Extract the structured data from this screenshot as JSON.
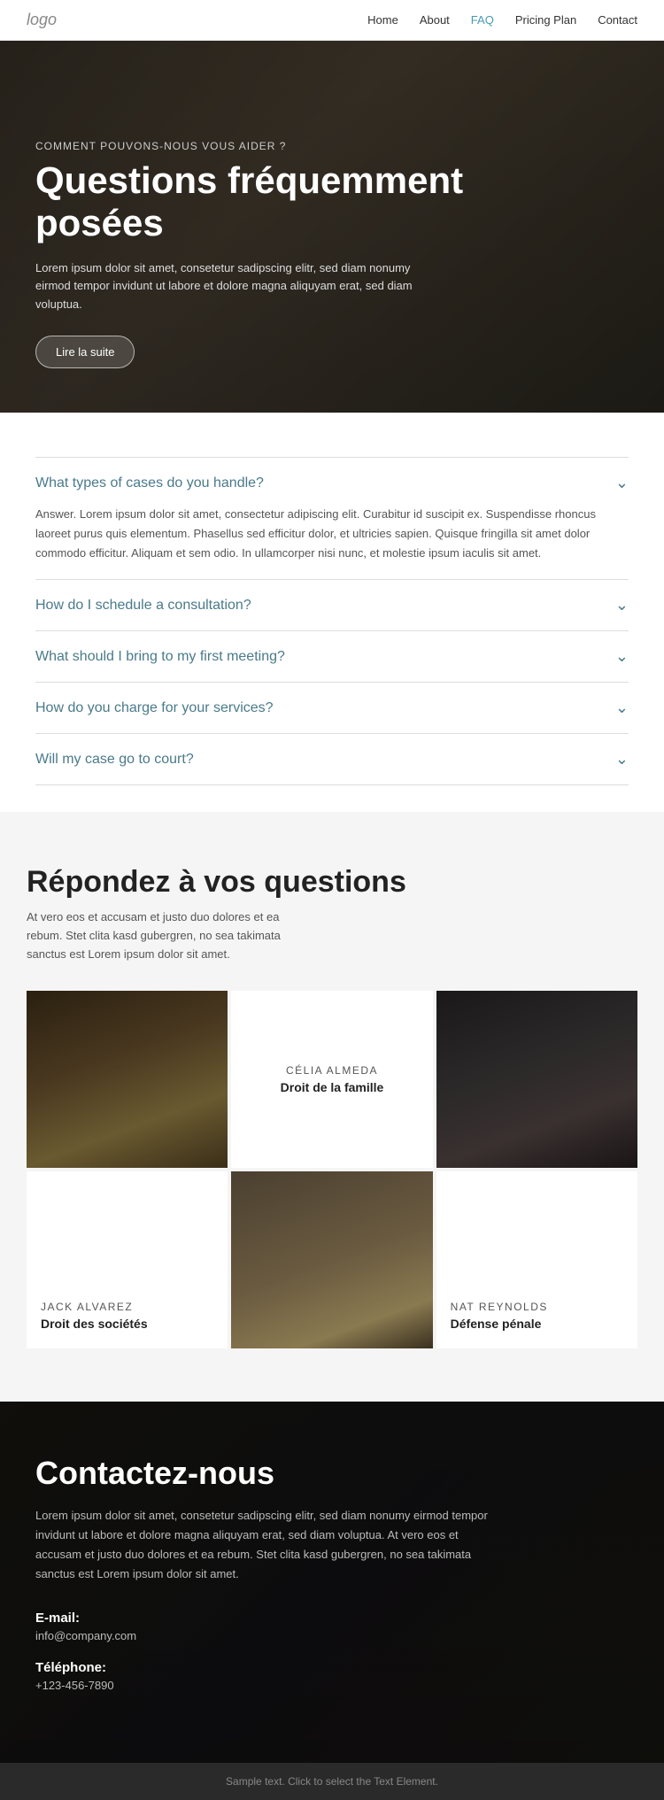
{
  "logo": "logo",
  "nav": {
    "links": [
      {
        "label": "Home",
        "href": "#",
        "active": false
      },
      {
        "label": "About",
        "href": "#",
        "active": false
      },
      {
        "label": "FAQ",
        "href": "#",
        "active": true
      },
      {
        "label": "Pricing Plan",
        "href": "#",
        "active": false
      },
      {
        "label": "Contact",
        "href": "#",
        "active": false
      }
    ]
  },
  "hero": {
    "subtitle": "COMMENT POUVONS-NOUS VOUS AIDER ?",
    "title": "Questions fréquemment posées",
    "description": "Lorem ipsum dolor sit amet, consetetur sadipscing elitr, sed diam nonumy eirmod tempor invidunt ut labore et dolore magna aliquyam erat, sed diam voluptua.",
    "button_label": "Lire la suite"
  },
  "faq": {
    "items": [
      {
        "question": "What types of cases do you handle?",
        "answer": "Answer. Lorem ipsum dolor sit amet, consectetur adipiscing elit. Curabitur id suscipit ex. Suspendisse rhoncus laoreet purus quis elementum. Phasellus sed efficitur dolor, et ultricies sapien. Quisque fringilla sit amet dolor commodo efficitur. Aliquam et sem odio. In ullamcorper nisi nunc, et molestie ipsum iaculis sit amet.",
        "open": true
      },
      {
        "question": "How do I schedule a consultation?",
        "answer": "",
        "open": false
      },
      {
        "question": "What should I bring to my first meeting?",
        "answer": "",
        "open": false
      },
      {
        "question": "How do you charge for your services?",
        "answer": "",
        "open": false
      },
      {
        "question": "Will my case go to court?",
        "answer": "",
        "open": false
      }
    ]
  },
  "team": {
    "title": "Répondez à vos questions",
    "description": "At vero eos et accusam et justo duo dolores et ea rebum. Stet clita kasd gubergren, no sea takimata sanctus est Lorem ipsum dolor sit amet.",
    "members": [
      {
        "name": "CÉLIA ALMEDA",
        "role": "Droit de la famille",
        "photo": "woman-center"
      },
      {
        "name": "JACK ALVAREZ",
        "role": "Droit des sociétés",
        "photo": "man-left"
      },
      {
        "name": "NAT REYNOLDS",
        "role": "Défense pénale",
        "photo": "woman-right"
      }
    ]
  },
  "contact": {
    "title": "Contactez-nous",
    "description": "Lorem ipsum dolor sit amet, consetetur sadipscing elitr, sed diam nonumy eirmod tempor invidunt ut labore et dolore magna aliquyam erat, sed diam voluptua. At vero eos et accusam et justo duo dolores et ea rebum. Stet clita kasd gubergren, no sea takimata sanctus est Lorem ipsum dolor sit amet.",
    "email_label": "E-mail:",
    "email_value": "info@company.com",
    "phone_label": "Téléphone:",
    "phone_value": "+123-456-7890"
  },
  "footer": {
    "text": "Sample text. Click to select the Text Element."
  }
}
